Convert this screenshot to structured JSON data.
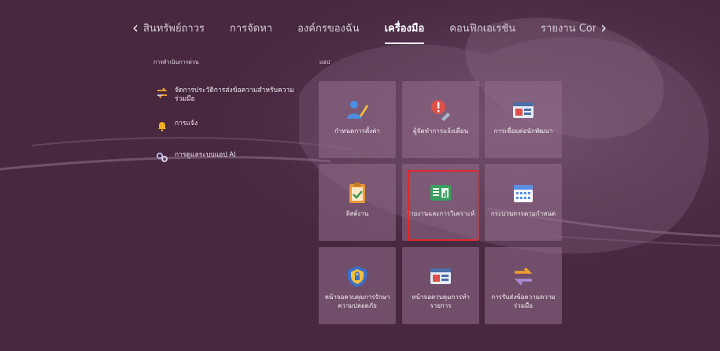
{
  "tabs": {
    "prev_arrow": "‹",
    "next_arrow": "›",
    "items": [
      "สินทรัพย์ถาวร",
      "การจัดหา",
      "องค์กรของฉัน",
      "เครื่องมือ",
      "คอนฟิกเอเรชัน",
      "รายงาน Core Utilities"
    ],
    "active_index": 3
  },
  "sections": {
    "quick_actions": "การดำเนินการด่วน",
    "apps": "แอป"
  },
  "quick_actions": [
    {
      "label": "จัดการประวัติการส่งข้อความสำหรับความร่วมมือ",
      "icon": "swap-arrows-icon"
    },
    {
      "label": "การแจ้ง",
      "icon": "bell-icon"
    },
    {
      "label": "การดูแลระบบแอป AI",
      "icon": "gears-icon"
    }
  ],
  "apps": [
    {
      "label": "กำหนดการตั้งค่า",
      "icon": "user-edit-icon"
    },
    {
      "label": "ผู้จัดทำการแจ้งเตือน",
      "icon": "alert-wrench-icon"
    },
    {
      "label": "การเชื่อมต่อนักพัฒนา",
      "icon": "developer-board-icon"
    },
    {
      "label": "ลิสต์งาน",
      "icon": "clipboard-check-icon"
    },
    {
      "label": "รายงานและการวิเคราะห์",
      "icon": "report-analytics-icon"
    },
    {
      "label": "กระบวนการตามกำหนด",
      "icon": "calendar-icon"
    },
    {
      "label": "หน้าจอควบคุมการรักษาความปลอดภัย",
      "icon": "security-shield-icon"
    },
    {
      "label": "หน้าจอควบคุมการทำรายการ",
      "icon": "transaction-board-icon"
    },
    {
      "label": "การรับส่งข้อความความร่วมมือ",
      "icon": "collaboration-arrows-icon"
    }
  ],
  "colors": {
    "background": "#4a2a45",
    "tile": "#8a6783",
    "highlight": "#e02a2a"
  }
}
